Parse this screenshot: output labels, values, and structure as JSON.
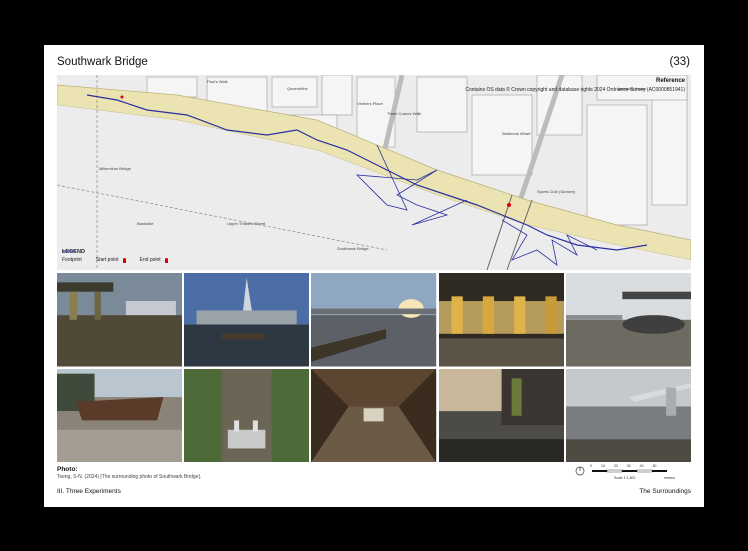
{
  "header": {
    "title": "Southwark Bridge",
    "page_number": "(33)"
  },
  "map": {
    "reference_label": "Reference",
    "copyright": "Contains OS data © Crown copyright and database rights 2024 Ordnance Survey (AC0000851941)",
    "labels": [
      "Millennium Bridge",
      "Southwark Bridge",
      "Sports Club (Sunken)",
      "Jameson House",
      "Walbrook Wharf",
      "Vintners Place",
      "Three Cranes Walk",
      "Queenhithe",
      "Paul's Walk",
      "Upper Thames Street",
      "Bankside"
    ],
    "legend": {
      "heading": "LEGEND",
      "footprint": "Footprint",
      "start": "Start point",
      "end": "End point"
    },
    "colors": {
      "footprint": "#2b2fa0",
      "river": "#ffffff",
      "embankment": "#ece3b2",
      "pin": "#d00000"
    }
  },
  "photos": [
    {
      "name": "photo-1",
      "kind": "bridge-underside"
    },
    {
      "name": "photo-2",
      "kind": "shard-skyline"
    },
    {
      "name": "photo-3",
      "kind": "river-sunset"
    },
    {
      "name": "photo-4",
      "kind": "bridge-pillars"
    },
    {
      "name": "photo-5",
      "kind": "bridge-foreshore"
    },
    {
      "name": "photo-6",
      "kind": "barge"
    },
    {
      "name": "photo-7",
      "kind": "mossy-wall"
    },
    {
      "name": "photo-8",
      "kind": "tunnel"
    },
    {
      "name": "photo-9",
      "kind": "low-tide"
    },
    {
      "name": "photo-10",
      "kind": "millennium-bridge"
    }
  ],
  "caption": {
    "heading": "Photo:",
    "text": "Tseng, S-N. (2024) [The surrounding photo of Southwark Bridge]."
  },
  "scale": {
    "ticks": [
      "0",
      "10",
      "20",
      "30",
      "40",
      "50"
    ],
    "unit": "metres",
    "label": "Scale 1:1,500"
  },
  "footer": {
    "left": "III. Three Experiments",
    "right": "The Surroundings"
  }
}
